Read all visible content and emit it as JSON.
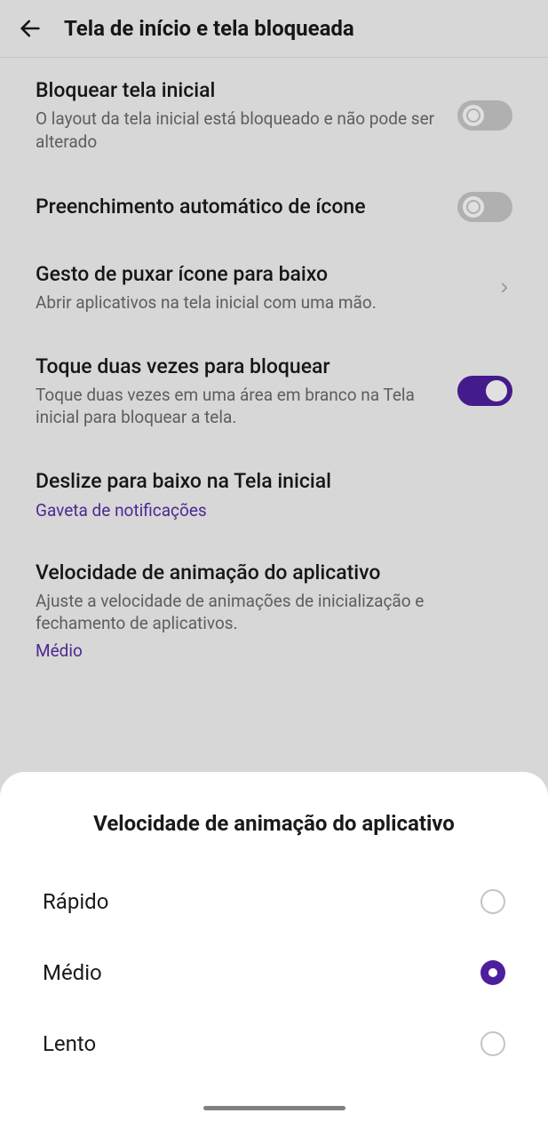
{
  "header": {
    "title": "Tela de início e tela bloqueada"
  },
  "settings": {
    "lock_home": {
      "title": "Bloquear tela inicial",
      "desc": "O layout da tela inicial está bloqueado e não pode ser alterado",
      "enabled": false
    },
    "auto_fill_icon": {
      "title": "Preenchimento automático de ícone",
      "enabled": false
    },
    "pull_down_gesture": {
      "title": "Gesto de puxar ícone para baixo",
      "desc": "Abrir aplicativos na tela inicial com uma mão."
    },
    "double_tap_lock": {
      "title": "Toque duas vezes para bloquear",
      "desc": "Toque duas vezes em uma área em branco na Tela inicial para bloquear a tela.",
      "enabled": true
    },
    "swipe_down": {
      "title": "Deslize para baixo na Tela inicial",
      "value": "Gaveta de notificações"
    },
    "anim_speed": {
      "title": "Velocidade de animação do aplicativo",
      "desc": "Ajuste a velocidade de animações de inicialização e fechamento de aplicativos.",
      "value": "Médio"
    }
  },
  "sheet": {
    "title": "Velocidade de animação do aplicativo",
    "options": [
      {
        "label": "Rápido",
        "selected": false
      },
      {
        "label": "Médio",
        "selected": true
      },
      {
        "label": "Lento",
        "selected": false
      }
    ]
  }
}
